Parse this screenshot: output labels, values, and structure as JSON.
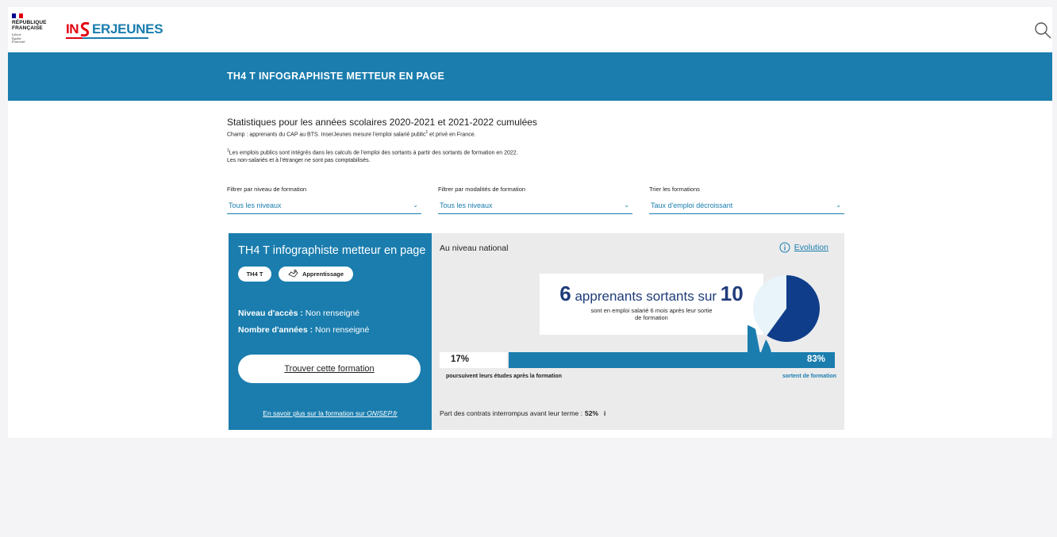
{
  "header": {
    "republic_line1": "RÉPUBLIQUE",
    "republic_line2": "FRANÇAISE",
    "motto": [
      "Liberté",
      "Égalité",
      "Fraternité"
    ],
    "logo_in": "IN",
    "logo_rest": "ERJEUNES",
    "search_icon": "search-icon"
  },
  "banner": {
    "title": "TH4 T INFOGRAPHISTE METTEUR EN PAGE"
  },
  "intro": {
    "title": "Statistiques pour les années scolaires 2020-2021 et 2021-2022 cumulées",
    "scope_a": "Champ : apprenants du CAP au BTS. InserJeunes mesure l’emploi salarié public",
    "scope_sup": "1",
    "scope_b": " et privé en France.",
    "note1_sup": "1",
    "note1": "Les emplois publics sont intégrés dans les calculs de l’emploi des sortants à partir des sortants de formation en 2022.",
    "note2": "Les non-salariés et à l’étranger ne sont pas comptabilisés."
  },
  "filters": [
    {
      "label": "Filtrer par niveau de formation",
      "value": "Tous les niveaux"
    },
    {
      "label": "Filtrer par modalités de formation",
      "value": "Tous les niveaux"
    },
    {
      "label": "Trier les formations",
      "value": "Taux d'emploi décroissant"
    }
  ],
  "formation": {
    "title": "TH4 T infographiste metteur en page",
    "badge_code": "TH4 T",
    "badge_mode": "Apprentissage",
    "access_label": "Niveau d'accès :",
    "access_value": " Non renseigné",
    "years_label": "Nombre d'années :",
    "years_value": " Non renseigné",
    "find_button": "Trouver cette formation",
    "onisep_text": "En savoir plus sur la formation sur ",
    "onisep_site": "ONISEP.fr"
  },
  "national": {
    "title": "Au niveau national",
    "evolution": "Evolution",
    "employed": "6",
    "employed_text": " apprenants sortants sur ",
    "total": "10",
    "employed_subtitle": "sont en emploi salarié 6 mois après leur sortie de formation",
    "employed_fraction": 0.6,
    "continue_pct": "17%",
    "exit_pct": "83%",
    "continue_fraction": 0.17,
    "continue_caption": "poursuivent leurs études après la formation",
    "exit_caption": "sortent de formation",
    "contracts_label": "Part des contrats interrompus avant leur terme :",
    "contracts_value": "52%",
    "info_symbol": "i"
  },
  "colors": {
    "primary": "#1a7dae",
    "dark_blue": "#1f3c7a",
    "pie_dark": "#0f3d8a",
    "pie_light": "#e8f4fa",
    "marianne_red": "#e1000f"
  }
}
